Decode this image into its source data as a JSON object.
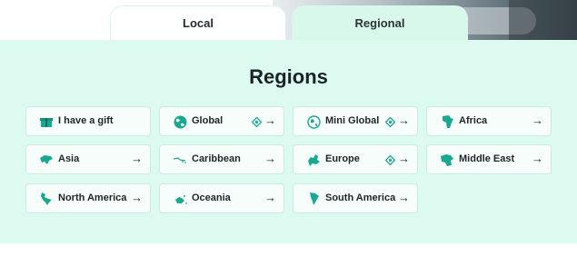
{
  "colors": {
    "accent": "#1aa891",
    "panel": "#dcfaef",
    "tab_active": "#d9f8ec"
  },
  "tabs": [
    {
      "label": "Local",
      "active": false
    },
    {
      "label": "Regional",
      "active": true
    }
  ],
  "section": {
    "title": "Regions"
  },
  "regions": [
    {
      "label": "I have a gift",
      "icon": "gift-icon"
    },
    {
      "label": "Global",
      "icon": "globe-icon",
      "badge": "esim-icon",
      "arrow": "→"
    },
    {
      "label": "Mini Global",
      "icon": "mini-globe-icon",
      "badge": "esim-icon",
      "arrow": "→"
    },
    {
      "label": "Africa",
      "icon": "africa-map-icon",
      "arrow": "→"
    },
    {
      "label": "Asia",
      "icon": "asia-map-icon",
      "arrow": "→"
    },
    {
      "label": "Caribbean",
      "icon": "caribbean-map-icon",
      "arrow": "→"
    },
    {
      "label": "Europe",
      "icon": "europe-map-icon",
      "badge": "esim-icon",
      "arrow": "→"
    },
    {
      "label": "Middle East",
      "icon": "middle-east-map-icon",
      "arrow": "→"
    },
    {
      "label": "North America",
      "icon": "north-america-map-icon",
      "arrow": "→"
    },
    {
      "label": "Oceania",
      "icon": "oceania-map-icon",
      "arrow": "→"
    },
    {
      "label": "South America",
      "icon": "south-america-map-icon",
      "arrow": "→"
    }
  ]
}
